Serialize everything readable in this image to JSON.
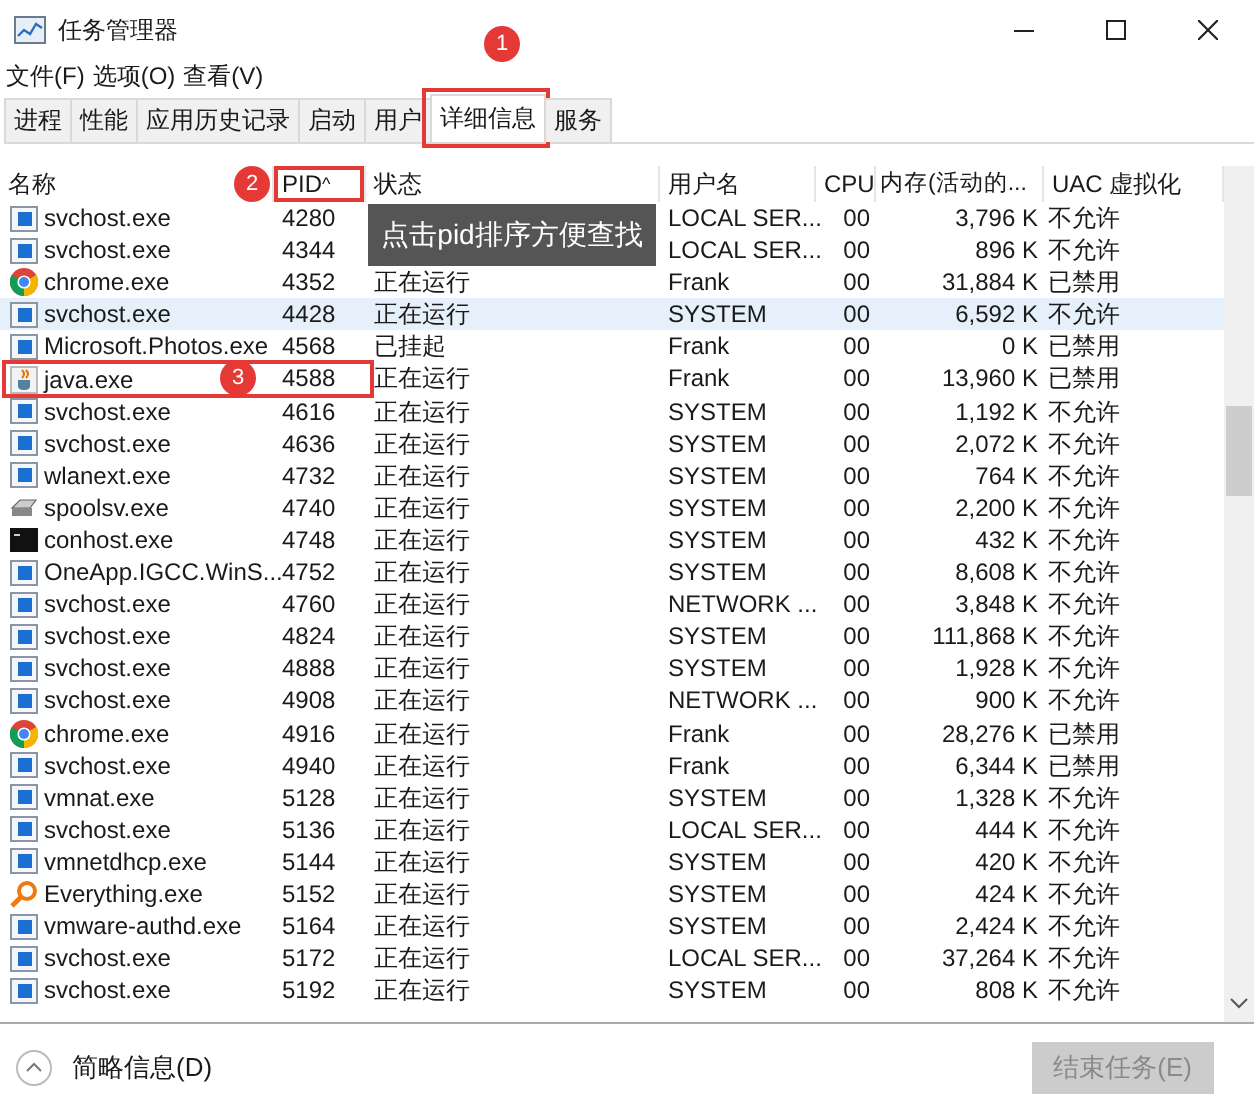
{
  "window": {
    "title": "任务管理器"
  },
  "menu": [
    "文件(F)",
    "选项(O)",
    "查看(V)"
  ],
  "tabs": [
    {
      "label": "进程",
      "selected": false
    },
    {
      "label": "性能",
      "selected": false
    },
    {
      "label": "应用历史记录",
      "selected": false
    },
    {
      "label": "启动",
      "selected": false
    },
    {
      "label": "用户",
      "selected": false
    },
    {
      "label": "详细信息",
      "selected": true,
      "highlighted": true,
      "badge": "1"
    },
    {
      "label": "服务",
      "selected": false
    }
  ],
  "table": {
    "columns": [
      {
        "label": "名称"
      },
      {
        "label": "PID",
        "sort": "^",
        "highlighted": true,
        "badge": "2"
      },
      {
        "label": "状态"
      },
      {
        "label": "用户名"
      },
      {
        "label": "CPU"
      },
      {
        "label": "内存(活动的..."
      },
      {
        "label": "UAC 虚拟化"
      }
    ],
    "rows": [
      {
        "kind": "service",
        "name": "svchost.exe",
        "pid": "4280",
        "user": "LOCAL SER...",
        "cpu": "00",
        "memory": "3,796 K",
        "uac": "不允许",
        "selected": false
      },
      {
        "kind": "service",
        "name": "svchost.exe",
        "pid": "4344",
        "user": "LOCAL SER...",
        "cpu": "00",
        "memory": "896 K",
        "uac": "不允许",
        "selected": false
      },
      {
        "kind": "browser",
        "name": "chrome.exe",
        "pid": "4352",
        "status": "正在运行",
        "user": "Frank",
        "cpu": "00",
        "memory": "31,884 K",
        "uac": "已禁用",
        "selected": false
      },
      {
        "kind": "service",
        "name": "svchost.exe",
        "pid": "4428",
        "status": "正在运行",
        "user": "SYSTEM",
        "cpu": "00",
        "memory": "6,592 K",
        "uac": "不允许",
        "selected": true
      },
      {
        "kind": "service",
        "name": "Microsoft.Photos.exe",
        "pid": "4568",
        "status": "已挂起",
        "user": "Frank",
        "cpu": "00",
        "memory": "0 K",
        "uac": "已禁用",
        "selected": false
      },
      {
        "kind": "java",
        "name": "java.exe",
        "pid": "4588",
        "status": "正在运行",
        "user": "Frank",
        "cpu": "00",
        "memory": "13,960 K",
        "uac": "已禁用",
        "selected": false,
        "highlighted": true,
        "badge": "3"
      },
      {
        "kind": "service",
        "name": "svchost.exe",
        "pid": "4616",
        "status": "正在运行",
        "user": "SYSTEM",
        "cpu": "00",
        "memory": "1,192 K",
        "uac": "不允许",
        "selected": false
      },
      {
        "kind": "service",
        "name": "svchost.exe",
        "pid": "4636",
        "status": "正在运行",
        "user": "SYSTEM",
        "cpu": "00",
        "memory": "2,072 K",
        "uac": "不允许",
        "selected": false
      },
      {
        "kind": "service",
        "name": "wlanext.exe",
        "pid": "4732",
        "status": "正在运行",
        "user": "SYSTEM",
        "cpu": "00",
        "memory": "764 K",
        "uac": "不允许",
        "selected": false
      },
      {
        "kind": "printer",
        "name": "spoolsv.exe",
        "pid": "4740",
        "status": "正在运行",
        "user": "SYSTEM",
        "cpu": "00",
        "memory": "2,200 K",
        "uac": "不允许",
        "selected": false
      },
      {
        "kind": "console",
        "name": "conhost.exe",
        "pid": "4748",
        "status": "正在运行",
        "user": "SYSTEM",
        "cpu": "00",
        "memory": "432 K",
        "uac": "不允许",
        "selected": false
      },
      {
        "kind": "service",
        "name": "OneApp.IGCC.WinS...",
        "pid": "4752",
        "status": "正在运行",
        "user": "SYSTEM",
        "cpu": "00",
        "memory": "8,608 K",
        "uac": "不允许",
        "selected": false
      },
      {
        "kind": "service",
        "name": "svchost.exe",
        "pid": "4760",
        "status": "正在运行",
        "user": "NETWORK ...",
        "cpu": "00",
        "memory": "3,848 K",
        "uac": "不允许",
        "selected": false
      },
      {
        "kind": "service",
        "name": "svchost.exe",
        "pid": "4824",
        "status": "正在运行",
        "user": "SYSTEM",
        "cpu": "00",
        "memory": "111,868 K",
        "uac": "不允许",
        "selected": false
      },
      {
        "kind": "service",
        "name": "svchost.exe",
        "pid": "4888",
        "status": "正在运行",
        "user": "SYSTEM",
        "cpu": "00",
        "memory": "1,928 K",
        "uac": "不允许",
        "selected": false
      },
      {
        "kind": "service",
        "name": "svchost.exe",
        "pid": "4908",
        "status": "正在运行",
        "user": "NETWORK ...",
        "cpu": "00",
        "memory": "900 K",
        "uac": "不允许",
        "selected": false
      },
      {
        "kind": "browser",
        "name": "chrome.exe",
        "pid": "4916",
        "status": "正在运行",
        "user": "Frank",
        "cpu": "00",
        "memory": "28,276 K",
        "uac": "已禁用",
        "selected": false
      },
      {
        "kind": "service",
        "name": "svchost.exe",
        "pid": "4940",
        "status": "正在运行",
        "user": "Frank",
        "cpu": "00",
        "memory": "6,344 K",
        "uac": "已禁用",
        "selected": false
      },
      {
        "kind": "service",
        "name": "vmnat.exe",
        "pid": "5128",
        "status": "正在运行",
        "user": "SYSTEM",
        "cpu": "00",
        "memory": "1,328 K",
        "uac": "不允许",
        "selected": false
      },
      {
        "kind": "service",
        "name": "svchost.exe",
        "pid": "5136",
        "status": "正在运行",
        "user": "LOCAL SER...",
        "cpu": "00",
        "memory": "444 K",
        "uac": "不允许",
        "selected": false
      },
      {
        "kind": "service",
        "name": "vmnetdhcp.exe",
        "pid": "5144",
        "status": "正在运行",
        "user": "SYSTEM",
        "cpu": "00",
        "memory": "420 K",
        "uac": "不允许",
        "selected": false
      },
      {
        "kind": "search",
        "name": "Everything.exe",
        "pid": "5152",
        "status": "正在运行",
        "user": "SYSTEM",
        "cpu": "00",
        "memory": "424 K",
        "uac": "不允许",
        "selected": false
      },
      {
        "kind": "service",
        "name": "vmware-authd.exe",
        "pid": "5164",
        "status": "正在运行",
        "user": "SYSTEM",
        "cpu": "00",
        "memory": "2,424 K",
        "uac": "不允许",
        "selected": false
      },
      {
        "kind": "service",
        "name": "svchost.exe",
        "pid": "5172",
        "status": "正在运行",
        "user": "LOCAL SER...",
        "cpu": "00",
        "memory": "37,264 K",
        "uac": "不允许",
        "selected": false
      },
      {
        "kind": "service",
        "name": "svchost.exe",
        "pid": "5192",
        "status": "正在运行",
        "user": "SYSTEM",
        "cpu": "00",
        "memory": "808 K",
        "uac": "不允许",
        "selected": false
      }
    ]
  },
  "tooltip": {
    "text": "点击pid排序方便查找"
  },
  "footer": {
    "details_link": "简略信息(D)",
    "end_task_button": {
      "label": "结束任务(E)",
      "disabled": true
    }
  }
}
